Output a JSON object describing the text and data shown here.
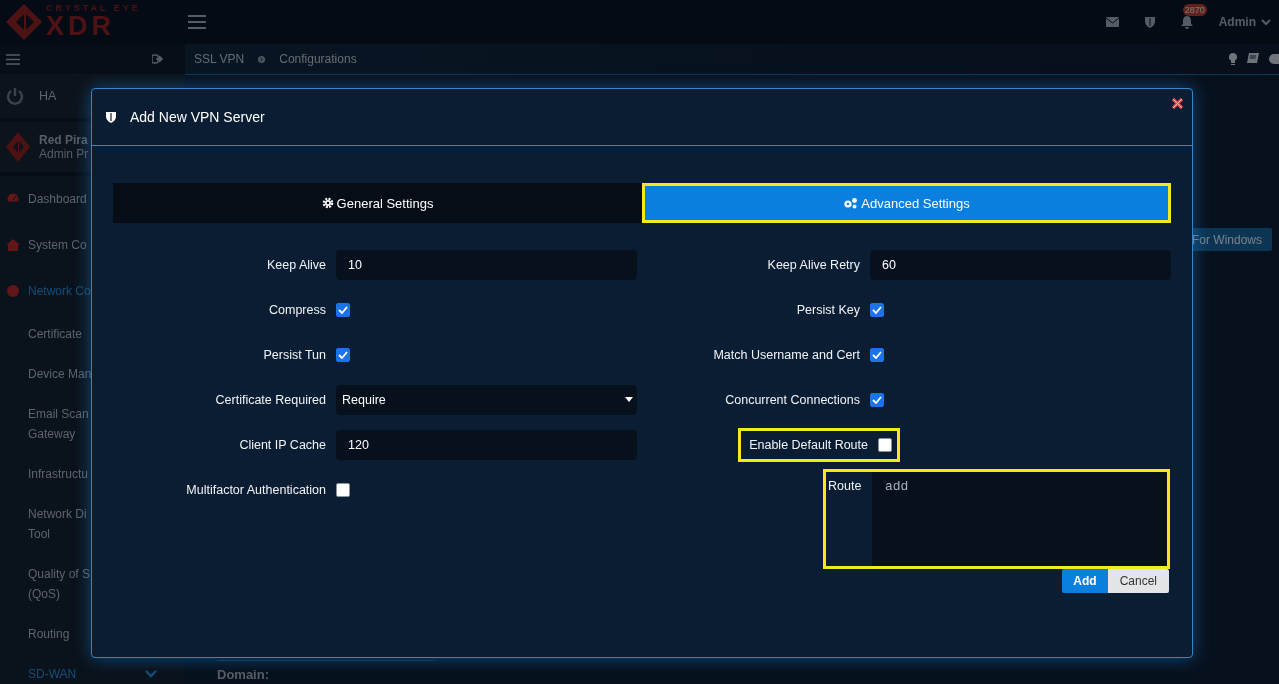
{
  "header": {
    "logo_top": "CRYSTAL EYE",
    "logo_main": "XDR",
    "notification_count": "2870",
    "user": "Admin"
  },
  "sidebar": {
    "items": [
      {
        "kind": "ha",
        "lines": [
          "HA"
        ]
      },
      {
        "kind": "profile",
        "lines": [
          "Red Pira",
          "Admin Pr"
        ]
      },
      {
        "kind": "main",
        "lines": [
          "Dashboard"
        ],
        "active": false
      },
      {
        "kind": "main",
        "lines": [
          "System Co"
        ],
        "active": false
      },
      {
        "kind": "main",
        "lines": [
          "Network Co"
        ],
        "active": true
      },
      {
        "kind": "sub",
        "lines": [
          "Certificate"
        ],
        "active": false
      },
      {
        "kind": "sub",
        "lines": [
          "Device Man"
        ],
        "active": false
      },
      {
        "kind": "sub",
        "lines": [
          "Email Scan",
          "Gateway"
        ],
        "active": false
      },
      {
        "kind": "sub",
        "lines": [
          "Infrastructu"
        ],
        "active": false
      },
      {
        "kind": "sub",
        "lines": [
          "Network Di",
          "Tool"
        ],
        "active": false
      },
      {
        "kind": "sub",
        "lines": [
          "Quality of S",
          "(QoS)"
        ],
        "active": false
      },
      {
        "kind": "sub",
        "lines": [
          "Routing"
        ],
        "active": false
      },
      {
        "kind": "sub",
        "lines": [
          "SD-WAN"
        ],
        "active": true,
        "expanded": true
      }
    ]
  },
  "breadcrumb": [
    "SSL VPN",
    "Configurations"
  ],
  "help_toggle": {
    "on": false
  },
  "page": {
    "download_button": "For Windows",
    "domain_label": "Domain:"
  },
  "modal": {
    "title": "Add New VPN Server",
    "tabs": [
      {
        "label": "General Settings",
        "selected": false,
        "highlighted": false
      },
      {
        "label": "Advanced Settings",
        "selected": true,
        "highlighted": true
      }
    ],
    "left_fields": [
      {
        "kind": "text",
        "label": "Keep Alive",
        "value": "10"
      },
      {
        "kind": "checkbox",
        "label": "Compress",
        "checked": true,
        "highlighted": false
      },
      {
        "kind": "checkbox",
        "label": "Persist Tun",
        "checked": true,
        "highlighted": false
      },
      {
        "kind": "select",
        "label": "Certificate Required",
        "value": "Require"
      },
      {
        "kind": "text",
        "label": "Client IP Cache",
        "value": "120"
      },
      {
        "kind": "checkbox",
        "label": "Multifactor Authentication",
        "checked": false,
        "highlighted": false
      }
    ],
    "right_fields": [
      {
        "kind": "text",
        "label": "Keep Alive Retry",
        "value": "60"
      },
      {
        "kind": "checkbox",
        "label": "Persist Key",
        "checked": true,
        "highlighted": false
      },
      {
        "kind": "checkbox",
        "label": "Match Username and Cert",
        "checked": true,
        "highlighted": false
      },
      {
        "kind": "checkbox",
        "label": "Concurrent Connections",
        "checked": true,
        "highlighted": false
      },
      {
        "kind": "checkbox",
        "label": "Enable Default Route",
        "checked": false,
        "highlighted": true
      },
      {
        "kind": "textarea",
        "label": "Route",
        "placeholder": "add",
        "highlighted": true
      }
    ],
    "buttons": [
      {
        "label": "Add",
        "kind": "primary"
      },
      {
        "label": "Cancel",
        "kind": "secondary"
      }
    ]
  }
}
